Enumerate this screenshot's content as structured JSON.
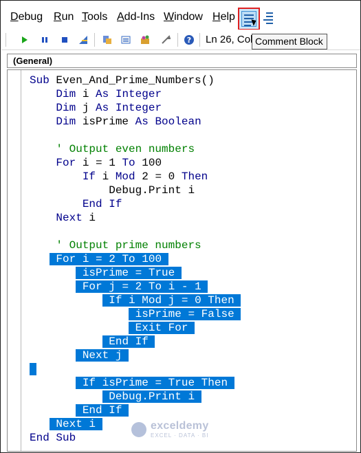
{
  "menu": {
    "items": [
      {
        "label": "Debug",
        "access_key": "D",
        "rest": "ebug"
      },
      {
        "label": "Run",
        "access_key": "R",
        "rest": "un"
      },
      {
        "label": "Tools",
        "access_key": "T",
        "rest": "ools"
      },
      {
        "label": "Add-Ins",
        "access_key": "A",
        "rest": "dd-Ins"
      },
      {
        "label": "Window",
        "access_key": "W",
        "rest": "indow"
      },
      {
        "label": "Help",
        "access_key": "H",
        "rest": "elp"
      }
    ]
  },
  "toolbar": {
    "icons": [
      "run-icon",
      "break-icon",
      "reset-icon",
      "design-mode-icon",
      "project-explorer-icon",
      "properties-icon",
      "object-browser-icon",
      "toolbox-icon",
      "help-icon",
      "comment-block-icon",
      "uncomment-block-icon"
    ],
    "status": "Ln 26, Col",
    "tooltip": "Comment Block"
  },
  "procedure_dropdown": {
    "value": "(General)"
  },
  "code": {
    "lines": [
      {
        "text": "Sub Even_And_Prime_Numbers()",
        "selected": false
      },
      {
        "text": "    Dim i As Integer",
        "selected": false
      },
      {
        "text": "    Dim j As Integer",
        "selected": false
      },
      {
        "text": "    Dim isPrime As Boolean",
        "selected": false
      },
      {
        "text": "",
        "selected": false
      },
      {
        "text": "    ' Output even numbers",
        "selected": false
      },
      {
        "text": "    For i = 1 To 100",
        "selected": false
      },
      {
        "text": "        If i Mod 2 = 0 Then",
        "selected": false
      },
      {
        "text": "            Debug.Print i",
        "selected": false
      },
      {
        "text": "        End If",
        "selected": false
      },
      {
        "text": "    Next i",
        "selected": false
      },
      {
        "text": "",
        "selected": false
      },
      {
        "text": "    ' Output prime numbers",
        "selected": false
      },
      {
        "text": "    For i = 2 To 100",
        "selected": true
      },
      {
        "text": "        isPrime = True",
        "selected": true
      },
      {
        "text": "        For j = 2 To i - 1",
        "selected": true
      },
      {
        "text": "            If i Mod j = 0 Then",
        "selected": true
      },
      {
        "text": "                isPrime = False",
        "selected": true
      },
      {
        "text": "                Exit For",
        "selected": true
      },
      {
        "text": "            End If",
        "selected": true
      },
      {
        "text": "        Next j",
        "selected": true
      },
      {
        "text": "",
        "selected": true
      },
      {
        "text": "        If isPrime = True Then",
        "selected": true
      },
      {
        "text": "            Debug.Print i",
        "selected": true
      },
      {
        "text": "        End If",
        "selected": true
      },
      {
        "text": "    Next i",
        "selected": true
      },
      {
        "text": "End Sub",
        "selected": false
      }
    ]
  },
  "watermark": {
    "name": "exceldemy",
    "tagline": "EXCEL · DATA · BI"
  },
  "colors": {
    "selection": "#0078d7",
    "comment": "#008000",
    "keyword": "#00008b",
    "highlight_border": "#e02020"
  }
}
